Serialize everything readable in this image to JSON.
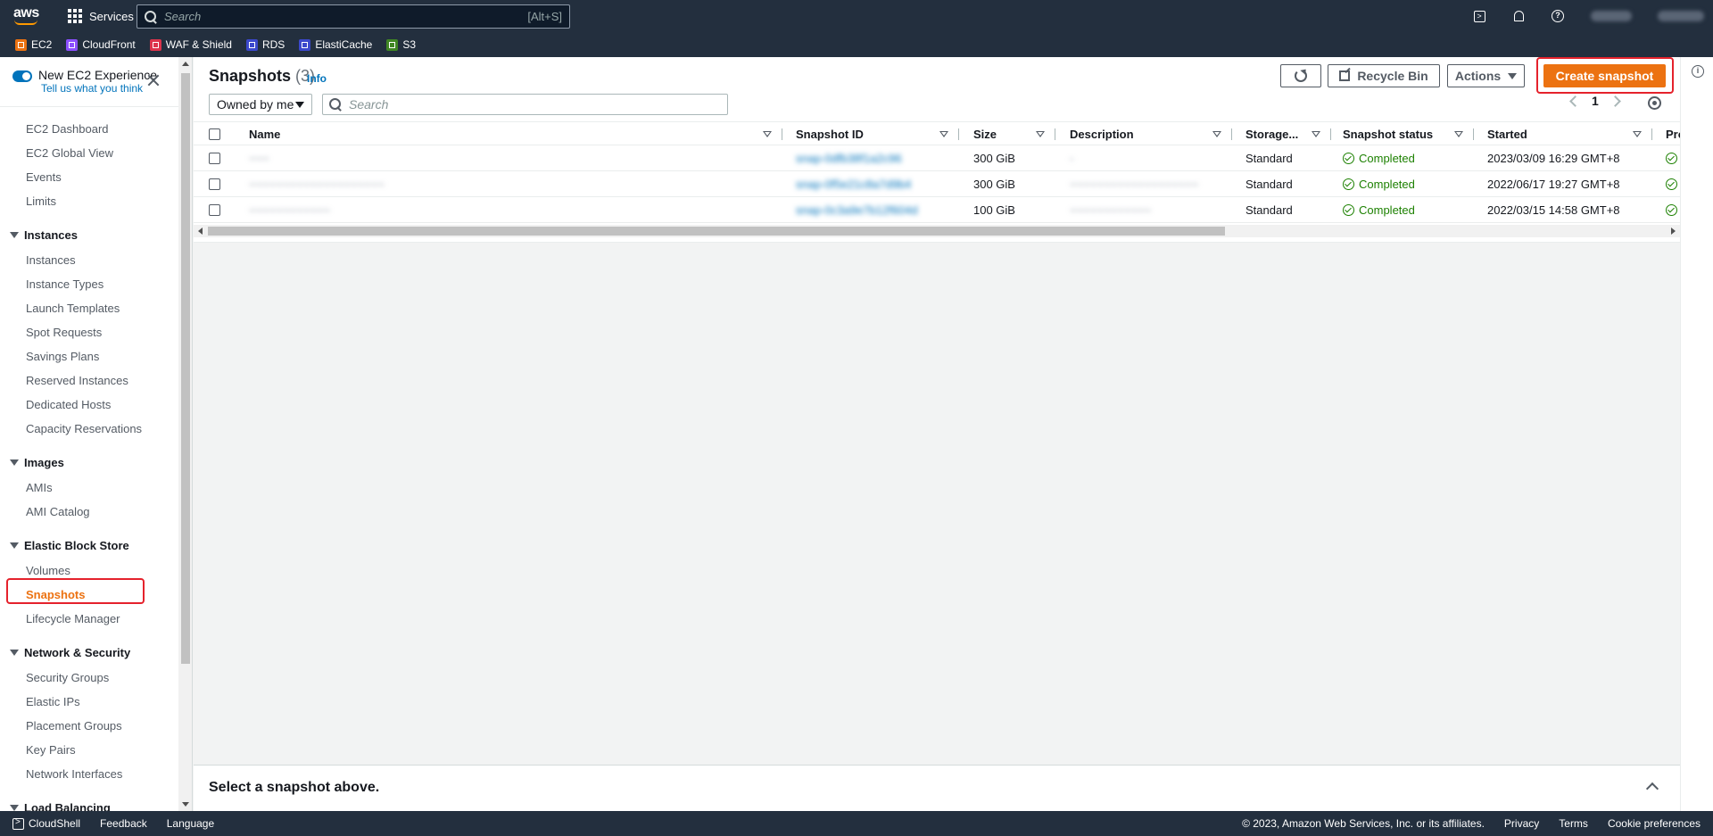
{
  "topnav": {
    "logo": "aws",
    "services_label": "Services",
    "search_placeholder": "Search",
    "search_shortcut": "[Alt+S]",
    "favorites": [
      {
        "label": "EC2",
        "color": "#ec7211"
      },
      {
        "label": "CloudFront",
        "color": "#8c4fff"
      },
      {
        "label": "WAF & Shield",
        "color": "#dd344c"
      },
      {
        "label": "RDS",
        "color": "#3b48cc"
      },
      {
        "label": "ElastiCache",
        "color": "#3b48cc"
      },
      {
        "label": "S3",
        "color": "#3f8624"
      }
    ]
  },
  "sidebar": {
    "toggle_label": "New EC2 Experience",
    "toggle_link": "Tell us what you think",
    "top_items": [
      "EC2 Dashboard",
      "EC2 Global View",
      "Events",
      "Limits"
    ],
    "sections": [
      {
        "title": "Instances",
        "items": [
          "Instances",
          "Instance Types",
          "Launch Templates",
          "Spot Requests",
          "Savings Plans",
          "Reserved Instances",
          "Dedicated Hosts",
          "Capacity Reservations"
        ]
      },
      {
        "title": "Images",
        "items": [
          "AMIs",
          "AMI Catalog"
        ]
      },
      {
        "title": "Elastic Block Store",
        "items": [
          "Volumes",
          "Snapshots",
          "Lifecycle Manager"
        ]
      },
      {
        "title": "Network & Security",
        "items": [
          "Security Groups",
          "Elastic IPs",
          "Placement Groups",
          "Key Pairs",
          "Network Interfaces"
        ]
      },
      {
        "title": "Load Balancing",
        "items": []
      }
    ],
    "active_item": "Snapshots"
  },
  "main": {
    "title": "Snapshots",
    "count": "(3)",
    "info_label": "Info",
    "recycle_bin_label": "Recycle Bin",
    "actions_label": "Actions",
    "create_label": "Create snapshot",
    "filter_value": "Owned by me",
    "search_placeholder": "Search",
    "page_number": "1",
    "columns": [
      "Name",
      "Snapshot ID",
      "Size",
      "Description",
      "Storage...",
      "Snapshot status",
      "Started",
      "Pro"
    ],
    "rows": [
      {
        "name": "~~~",
        "id": "snap-0dfb38f1a2c96",
        "size": "300 GiB",
        "description": "-",
        "storage": "Standard",
        "status": "Completed",
        "started": "2023/03/09 16:29 GMT+8"
      },
      {
        "name": "~~~~~~~~~~~~~~~~~~~~",
        "id": "snap-0f5e21c8a7d9b4",
        "size": "300 GiB",
        "description": "~~~~~~~~~~~~~~~~~~~",
        "storage": "Standard",
        "status": "Completed",
        "started": "2022/06/17 19:27 GMT+8"
      },
      {
        "name": "~~~~~~~~~~~~",
        "id": "snap-0c3a9e7b12f604d",
        "size": "100 GiB",
        "description": "~~~~~~~~~~~~",
        "storage": "Standard",
        "status": "Completed",
        "started": "2022/03/15 14:58 GMT+8"
      }
    ],
    "split_panel_title": "Select a snapshot above."
  },
  "footer": {
    "cloudshell": "CloudShell",
    "feedback": "Feedback",
    "language": "Language",
    "copyright": "© 2023, Amazon Web Services, Inc. or its affiliates.",
    "privacy": "Privacy",
    "terms": "Terms",
    "cookie": "Cookie preferences"
  }
}
